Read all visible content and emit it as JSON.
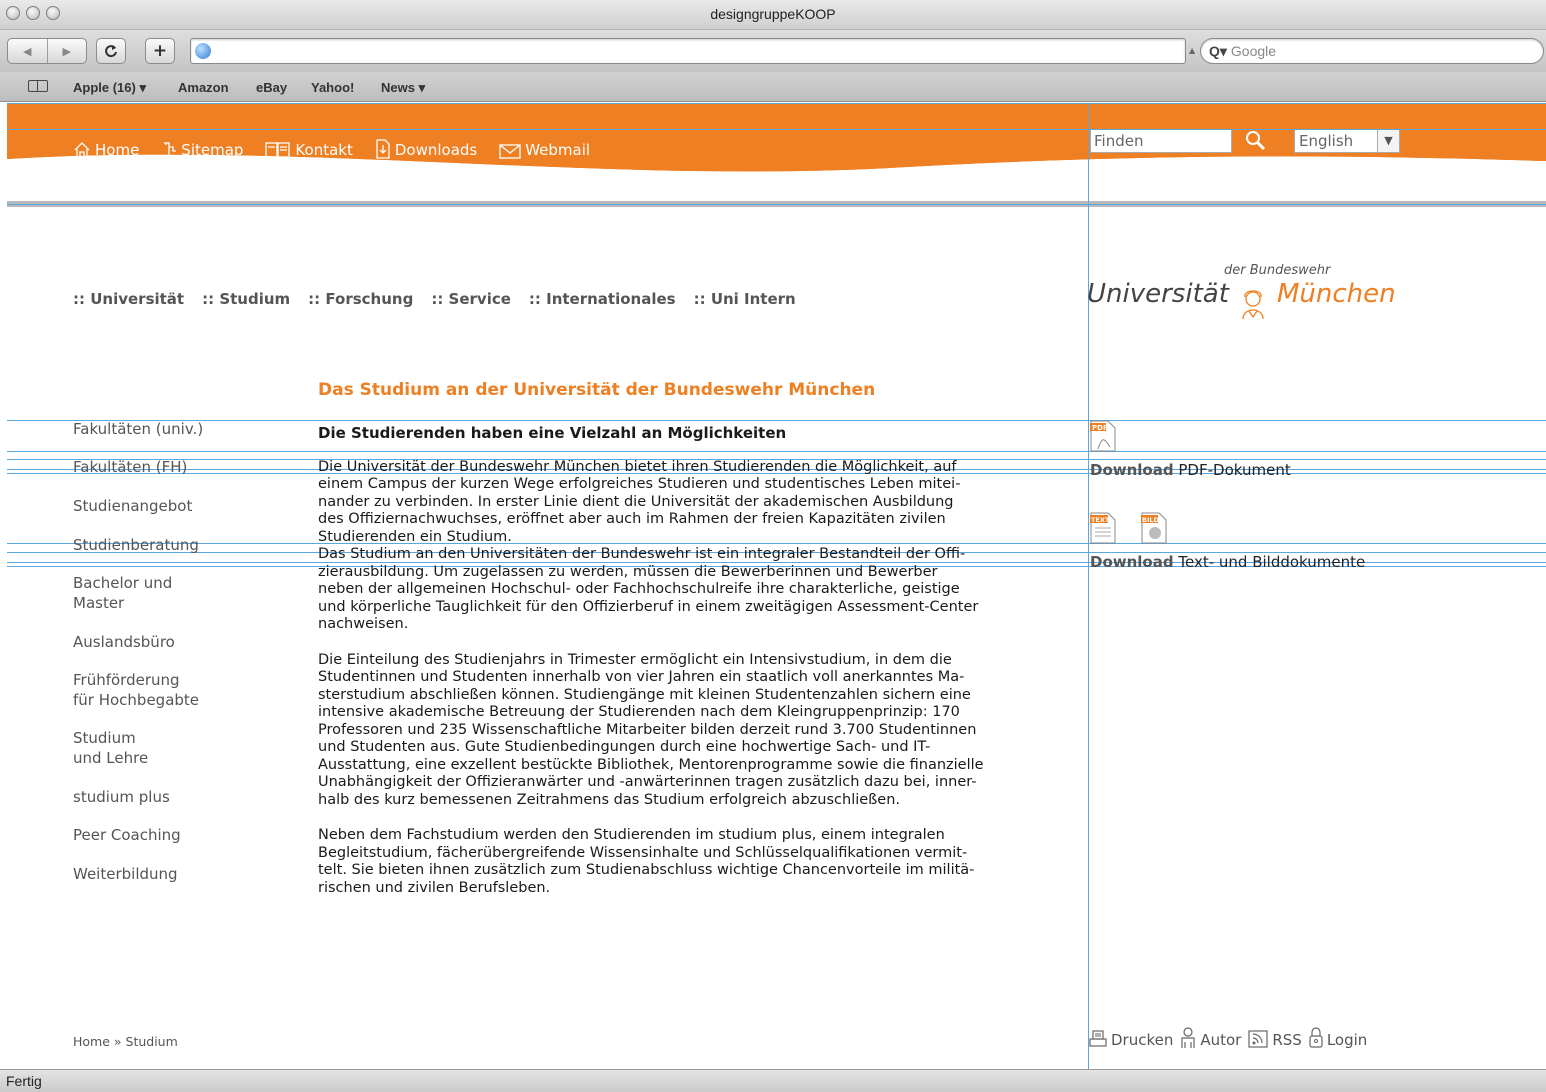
{
  "browser": {
    "window_title": "designgruppeKOOP",
    "search_placeholder": "Google",
    "bookmarks": [
      "Apple (16) ▾",
      "Amazon",
      "eBay",
      "Yahoo!",
      "News ▾"
    ],
    "status": "Fertig"
  },
  "header": {
    "nav": [
      "Home",
      "Sitemap",
      "Kontakt",
      "Downloads",
      "Webmail"
    ],
    "search_placeholder": "Finden",
    "language": "English",
    "brand_color": "#ee7f22"
  },
  "logo": {
    "top": "der Bundeswehr",
    "left": "Universität",
    "right": "München"
  },
  "mainnav": [
    ":: Universität",
    ":: Studium",
    ":: Forschung",
    ":: Service",
    ":: Internationales",
    ":: Uni Intern"
  ],
  "page_title": "Das Studium an der Universität der Bundeswehr München",
  "sidebar": [
    "Fakultäten (univ.)",
    "Fakultäten (FH)",
    "Studienangebot",
    "Studienberatung",
    "Bachelor und",
    "Master",
    "Auslandsbüro",
    "Frühförderung",
    "für Hochbegabte",
    "Studium",
    "und Lehre",
    "studium plus",
    "Peer Coaching",
    "Weiterbildung"
  ],
  "content": {
    "heading": "Die Studierenden haben eine Vielzahl an Möglichkeiten",
    "p1": [
      "Die Universität der Bundeswehr München bietet ihren Studierenden die Möglichkeit, auf",
      "einem Campus der kurzen Wege erfolgreiches Studieren und studentisches Leben mitei-",
      "nander zu verbinden. In erster Linie dient die Universität der akademischen Ausbildung",
      "des Offiziernachwuchses, eröffnet aber auch im Rahmen der freien Kapazitäten zivilen",
      "Studierenden ein Studium.",
      "Das Studium an den Universitäten der Bundeswehr ist ein integraler Bestandteil der Offi-",
      "zierausbildung. Um zugelassen zu werden, müssen die Bewerberinnen und Bewerber",
      "neben der allgemeinen Hochschul- oder Fachhochschulreife ihre charakterliche, geistige",
      "und körperliche Tauglichkeit für den Offizierberuf in einem zweitägigen Assessment-Center",
      "nachweisen."
    ],
    "p2": [
      "Die Einteilung des Studienjahrs in Trimester ermöglicht ein Intensivstudium, in dem die",
      "Studentinnen und Studenten innerhalb von vier Jahren ein staatlich voll anerkanntes Ma-",
      "sterstudium abschließen können. Studiengänge mit kleinen Studentenzahlen sichern eine",
      "intensive akademische Betreuung der Studierenden nach dem Kleingruppenprinzip: 170",
      "Professoren und 235 Wissenschaftliche Mitarbeiter bilden derzeit rund 3.700 Studentinnen",
      "und Studenten aus. Gute Studienbedingungen durch eine hochwertige Sach- und IT-",
      "Ausstattung, eine exzellent bestückte Bibliothek, Mentorenprogramme sowie die finanzielle",
      "Unabhängigkeit der Offizieranwärter und -anwärterinnen tragen zusätzlich dazu bei, inner-",
      "halb des kurz bemessenen Zeitrahmens das Studium erfolgreich abzuschließen."
    ],
    "p3": [
      "Neben dem Fachstudium werden den Studierenden im studium plus, einem integralen",
      "Begleitstudium, fächerübergreifende Wissensinhalte und Schlüsselqualifikationen vermit-",
      "telt. Sie bieten ihnen zusätzlich zum Studienabschluss wichtige Chancenvorteile im militä-",
      "rischen und zivilen Berufsleben."
    ]
  },
  "downloads": {
    "pdf_label_bold": "Download",
    "pdf_label": " PDF-Dokument",
    "pdf_badge": "PDF",
    "docs_label_bold": "Download",
    "docs_label": " Text- und Bilddokumente",
    "text_badge": "TEXT",
    "bild_badge": "BILD"
  },
  "footer": {
    "breadcrumb": "Home » Studium",
    "links": [
      "Drucken",
      "Autor",
      "RSS",
      "Login"
    ]
  }
}
